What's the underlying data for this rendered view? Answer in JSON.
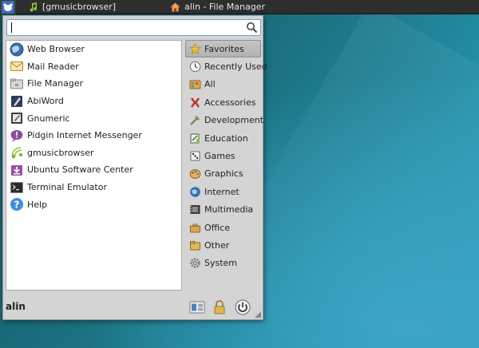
{
  "panel": {
    "tasks": [
      {
        "label": "[gmusicbrowser]",
        "icon": "music-note-icon"
      },
      {
        "label": "alin - File Manager",
        "icon": "home-folder-icon"
      }
    ]
  },
  "search": {
    "value": "",
    "placeholder": ""
  },
  "favorites": [
    {
      "label": "Web Browser",
      "icon": "web-browser-icon"
    },
    {
      "label": "Mail Reader",
      "icon": "mail-icon"
    },
    {
      "label": "File Manager",
      "icon": "file-manager-icon"
    },
    {
      "label": "AbiWord",
      "icon": "abiword-icon"
    },
    {
      "label": "Gnumeric",
      "icon": "gnumeric-icon"
    },
    {
      "label": "Pidgin Internet Messenger",
      "icon": "pidgin-icon"
    },
    {
      "label": "gmusicbrowser",
      "icon": "music-note-icon"
    },
    {
      "label": "Ubuntu Software Center",
      "icon": "software-center-icon"
    },
    {
      "label": "Terminal Emulator",
      "icon": "terminal-icon"
    },
    {
      "label": "Help",
      "icon": "help-icon"
    }
  ],
  "categories": [
    {
      "label": "Favorites",
      "icon": "star-icon",
      "active": true
    },
    {
      "label": "Recently Used",
      "icon": "clock-icon"
    },
    {
      "label": "All",
      "icon": "all-apps-icon"
    },
    {
      "label": "Accessories",
      "icon": "accessories-icon"
    },
    {
      "label": "Development",
      "icon": "development-icon"
    },
    {
      "label": "Education",
      "icon": "education-icon"
    },
    {
      "label": "Games",
      "icon": "games-icon"
    },
    {
      "label": "Graphics",
      "icon": "graphics-icon"
    },
    {
      "label": "Internet",
      "icon": "internet-icon"
    },
    {
      "label": "Multimedia",
      "icon": "multimedia-icon"
    },
    {
      "label": "Office",
      "icon": "office-icon"
    },
    {
      "label": "Other",
      "icon": "other-icon"
    },
    {
      "label": "System",
      "icon": "system-icon"
    }
  ],
  "footer": {
    "username": "alin",
    "buttons": [
      "settings-icon",
      "lock-icon",
      "power-icon"
    ]
  },
  "colors": {
    "panel": "#2e2e2e",
    "menu_bg": "#d4d4d4",
    "list_bg": "#ffffff",
    "search_border": "#6f9fcf",
    "desktop": "#1f6f8f"
  }
}
